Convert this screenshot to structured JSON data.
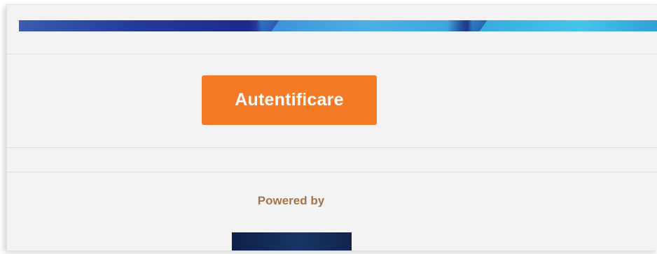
{
  "main": {
    "login_button_label": "Autentificare",
    "powered_by_label": "Powered by"
  },
  "colors": {
    "accent": "#f47a25",
    "powered_text": "#a5734a",
    "banner_blue": "#1c2a8a",
    "banner_cyan": "#47c4ec",
    "page_bg": "#f3f3f3"
  },
  "icons": {
    "brand": "brand-logo"
  }
}
